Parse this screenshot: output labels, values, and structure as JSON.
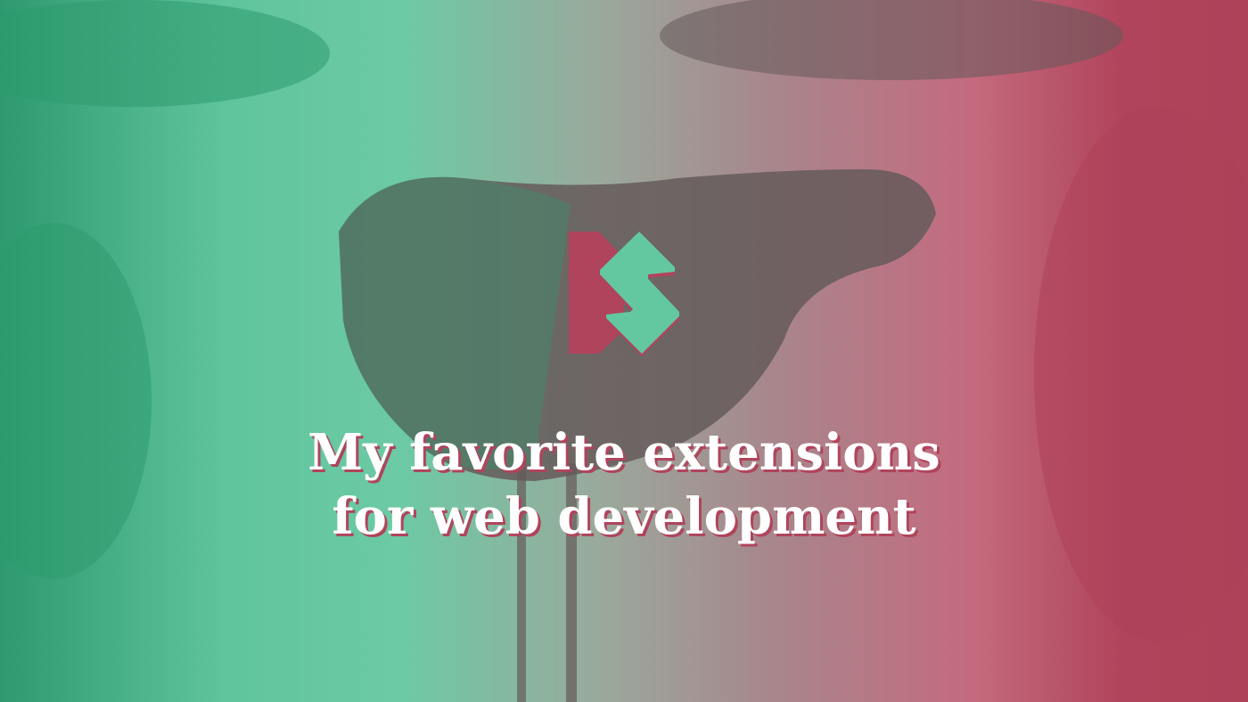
{
  "colors": {
    "green": "#63c8a0",
    "red": "#b0445c",
    "dark": "#655a5a"
  },
  "logo": {
    "icon": "bs-logo"
  },
  "title": {
    "line1": "My favorite extensions",
    "line2": "for web development"
  }
}
